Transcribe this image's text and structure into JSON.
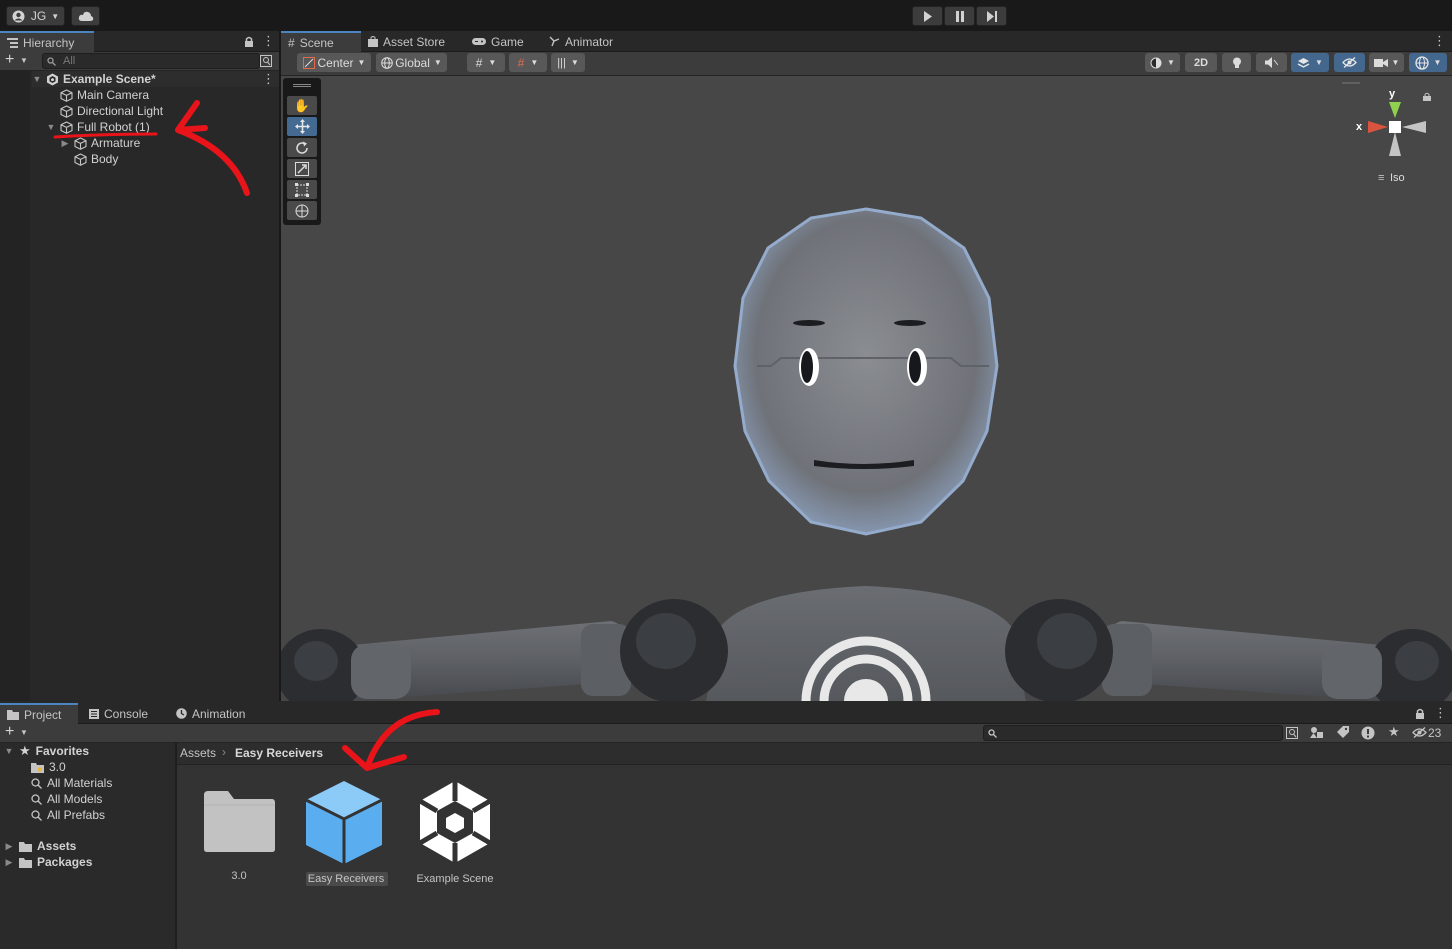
{
  "toolbar": {
    "account_label": "JG",
    "play_icon": "play-icon",
    "pause_icon": "pause-icon",
    "step_icon": "step-icon",
    "cloud_icon": "cloud-icon"
  },
  "hierarchy": {
    "tab_label": "Hierarchy",
    "search_placeholder": "All",
    "scene_name": "Example Scene*",
    "items": [
      {
        "label": "Main Camera"
      },
      {
        "label": "Directional Light"
      },
      {
        "label": "Full Robot (1)"
      },
      {
        "label": "Armature"
      },
      {
        "label": "Body"
      }
    ]
  },
  "scene": {
    "tabs": [
      {
        "label": "Scene",
        "icon": "grid-icon"
      },
      {
        "label": "Asset Store",
        "icon": "bag-icon"
      },
      {
        "label": "Game",
        "icon": "gamepad-icon"
      },
      {
        "label": "Animator",
        "icon": "animator-icon"
      }
    ],
    "pivot_mode": "Center",
    "pivot_rotation": "Global",
    "mode_2d": "2D",
    "gizmo_y": "y",
    "gizmo_x": "x",
    "projection": "Iso"
  },
  "project": {
    "tabs": [
      {
        "label": "Project"
      },
      {
        "label": "Console"
      },
      {
        "label": "Animation"
      }
    ],
    "hidden_count": "23",
    "favorites_label": "Favorites",
    "favorites": [
      {
        "label": "3.0"
      },
      {
        "label": "All Materials"
      },
      {
        "label": "All Models"
      },
      {
        "label": "All Prefabs"
      }
    ],
    "roots": [
      {
        "label": "Assets"
      },
      {
        "label": "Packages"
      }
    ],
    "breadcrumb": [
      "Assets",
      "Easy Receivers"
    ],
    "assets": [
      {
        "label": "3.0",
        "icon": "folder-icon"
      },
      {
        "label": "Easy Receivers",
        "icon": "package-icon"
      },
      {
        "label": "Example Scene",
        "icon": "unity-scene-icon"
      }
    ]
  },
  "colors": {
    "accent": "#4d85c2",
    "annotation": "#e8141a",
    "package_blue": "#5aaef0"
  }
}
